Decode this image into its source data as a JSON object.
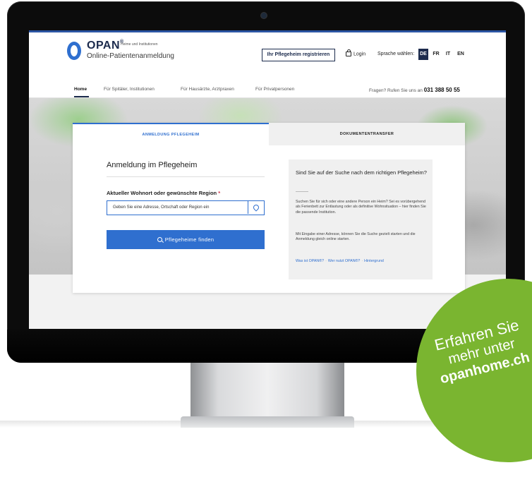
{
  "brand": {
    "name": "OPAN",
    "reg": "®",
    "tagline_small": "Heime und Institutionen",
    "tagline": "Online-Patientenanmeldung",
    "accent": "#2f6fcf",
    "dark": "#1c2b4d"
  },
  "header": {
    "register_button": "Ihr Pflegeheim registrieren",
    "login": "Login",
    "language_label": "Sprache wählen:",
    "languages": [
      "DE",
      "FR",
      "IT",
      "EN"
    ],
    "active_language": "DE"
  },
  "nav": {
    "items": [
      "Home",
      "Für Spitäler, Institutionen",
      "Für Hausärzte, Arztpraxen",
      "Für Privatpersonen"
    ],
    "hotline_text": "Fragen? Rufen Sie uns an",
    "hotline_number": "031 388 50 55"
  },
  "tabs": [
    "ANMELDUNG PFLEGEHEIM",
    "DOKUMENTENTRANSFER"
  ],
  "form": {
    "title": "Anmeldung im Pflegeheim",
    "label": "Aktueller Wohnort oder gewünschte Region",
    "required_mark": "*",
    "placeholder": "Geben Sie eine Adresse, Ortschaft oder Region ein",
    "submit": "Pflegeheime finden"
  },
  "info": {
    "title": "Sind Sie auf der Suche nach dem richtigen Pflegeheim?",
    "p1": "Suchen Sie für sich oder eine andere Person ein Heim? Sei es vorübergehend als Ferienbett zur Entlastung oder als definitive Wohnsituation – hier finden Sie die passende Institution.",
    "p2": "Mit Eingabe einer Adresse, können Sie die Suche gezielt starten und die Anmeldung gleich online starten.",
    "links": [
      "Was ist OPAN®?",
      "Wer nutzt OPAN®?",
      "Hintergrund"
    ]
  },
  "badge": {
    "line1": "Erfahren Sie",
    "line2": "mehr unter",
    "line3": "opanhome.ch",
    "color": "#7ab530"
  }
}
